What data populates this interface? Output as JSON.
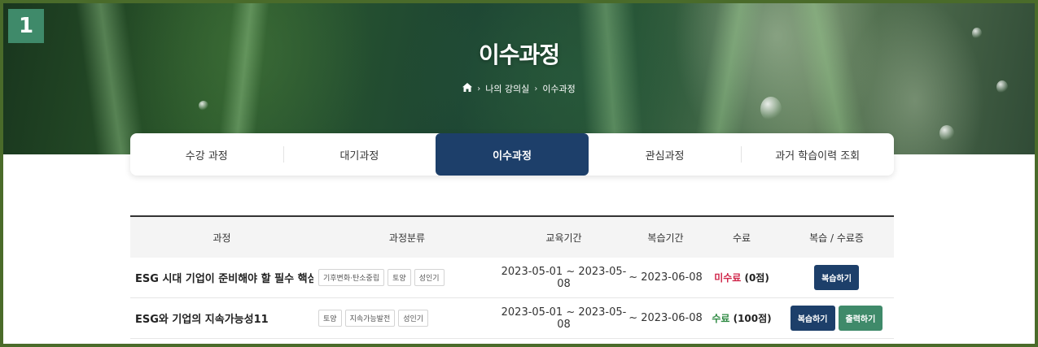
{
  "badge": "1",
  "hero": {
    "title": "이수과정",
    "breadcrumb": [
      "나의 강의실",
      "이수과정"
    ]
  },
  "tabs": [
    {
      "label": "수강 과정",
      "active": false
    },
    {
      "label": "대기과정",
      "active": false
    },
    {
      "label": "이수과정",
      "active": true
    },
    {
      "label": "관심과정",
      "active": false
    },
    {
      "label": "과거 학습이력 조회",
      "active": false
    }
  ],
  "table": {
    "headers": {
      "course": "과정",
      "category": "과정분류",
      "period": "교육기간",
      "review_period": "복습기간",
      "completion": "수료",
      "actions": "복습 / 수료증"
    },
    "rows": [
      {
        "title": "ESG 시대 기업이 준비해야 할 필수 핵심 ...",
        "tags": [
          "기후변화·탄소중립",
          "토양",
          "성인기"
        ],
        "period": "2023-05-01 ~ 2023-05-08",
        "review": "~ 2023-06-08",
        "status": "미수료",
        "score": "(0점)",
        "completed": false,
        "review_btn": "복습하기",
        "print_btn": ""
      },
      {
        "title": "ESG와 기업의 지속가능성11",
        "tags": [
          "토양",
          "지속가능발전",
          "성인기"
        ],
        "period": "2023-05-01 ~ 2023-05-08",
        "review": "~ 2023-06-08",
        "status": "수료",
        "score": "(100점)",
        "completed": true,
        "review_btn": "복습하기",
        "print_btn": "출력하기"
      }
    ]
  },
  "colors": {
    "primary": "#1d3f6a",
    "accent": "#3f8a6a",
    "fail": "#d0264a",
    "pass": "#2f8a43",
    "frame": "#4a6b2a"
  }
}
